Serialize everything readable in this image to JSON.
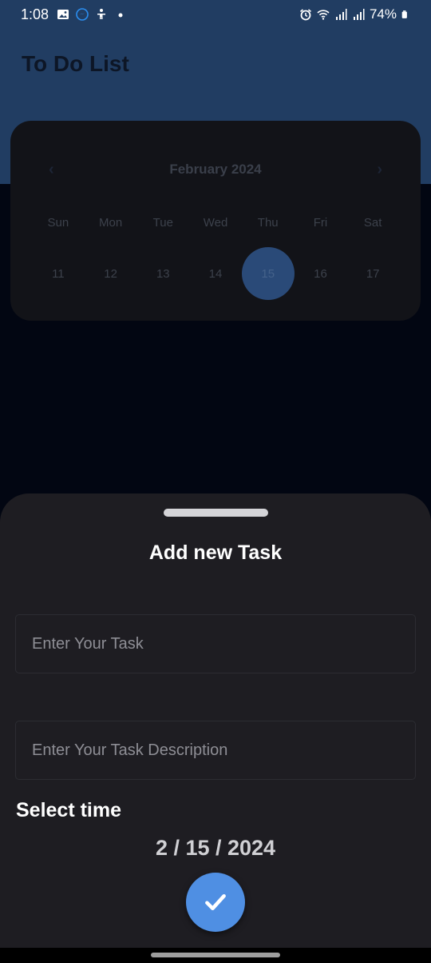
{
  "status_bar": {
    "time": "1:08",
    "left_icons": [
      "image-icon",
      "messenger-icon",
      "accessibility-icon",
      "dot-icon"
    ],
    "right_icons": [
      "alarm-icon",
      "wifi-icon",
      "signal-icon",
      "signal-icon",
      "battery-icon"
    ],
    "battery": "74%"
  },
  "app": {
    "title": "To Do List",
    "header_color": "#213d62",
    "background_color": "#020612"
  },
  "calendar": {
    "prev_icon": "‹",
    "next_icon": "›",
    "month": "February 2024",
    "weekdays": [
      "Sun",
      "Mon",
      "Tue",
      "Wed",
      "Thu",
      "Fri",
      "Sat"
    ],
    "days": [
      "11",
      "12",
      "13",
      "14",
      "15",
      "16",
      "17"
    ],
    "selected_day": "15"
  },
  "sheet": {
    "title": "Add new Task",
    "task_placeholder": "Enter Your Task",
    "description_placeholder": "Enter Your Task Description",
    "select_time_label": "Select time",
    "date_value": "2 / 15 / 2024",
    "submit_icon": "check-icon",
    "accent_color": "#4f8fe3",
    "sheet_color": "#1e1d22"
  }
}
